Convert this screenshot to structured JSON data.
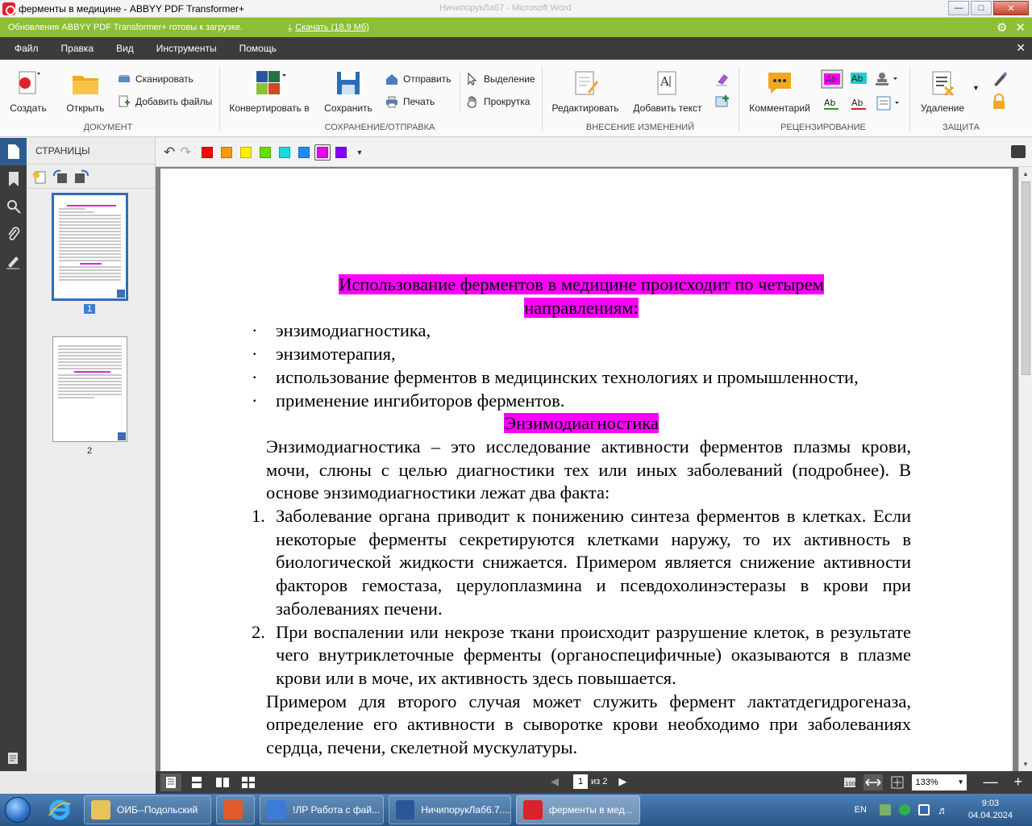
{
  "window": {
    "title": "ферменты в медицине - ABBYY PDF Transformer+",
    "ghost_title": "НичипорукЛаб7 - Microsoft Word"
  },
  "update_bar": {
    "message": "Обновления ABBYY PDF Transformer+ готовы к загрузке.",
    "download_link": "Скачать (18,9 Мб)"
  },
  "menu": [
    "Файл",
    "Правка",
    "Вид",
    "Инструменты",
    "Помощь"
  ],
  "ribbon": {
    "document": {
      "label": "ДОКУМЕНТ",
      "create": "Создать",
      "open": "Открыть",
      "scan": "Сканировать",
      "add_files": "Добавить файлы"
    },
    "save_send": {
      "label": "СОХРАНЕНИЕ/ОТПРАВКА",
      "convert": "Конвертировать в",
      "save": "Сохранить",
      "send": "Отправить",
      "print": "Печать",
      "select": "Выделение",
      "scroll": "Прокрутка"
    },
    "edit": {
      "label": "ВНЕСЕНИЕ ИЗМЕНЕНИЙ",
      "edit": "Редактировать",
      "add_text": "Добавить текст"
    },
    "review": {
      "label": "РЕЦЕНЗИРОВАНИЕ",
      "comment": "Комментарий"
    },
    "protect": {
      "label": "ЗАЩИТА",
      "delete": "Удаление"
    }
  },
  "pages_panel": {
    "header": "СТРАНИЦЫ",
    "pages": [
      "1",
      "2"
    ],
    "selected": "1"
  },
  "annot_colors": [
    "#ff0000",
    "#ff9900",
    "#ffee00",
    "#66dd00",
    "#11dddd",
    "#2288ff",
    "#ee00ee",
    "#8800ff"
  ],
  "selected_color": "#ee00ee",
  "document": {
    "heading1_a": "Использование ферментов в медицине происходит по четырем",
    "heading1_b": "направлениям",
    "heading1_colon": ":",
    "bullet_mark": "·",
    "bullets": [
      "энзимодиагностика,",
      "энзимотерапия,",
      "использование ферментов в медицинских технологиях и промышленности,",
      "применение ингибиторов ферментов."
    ],
    "heading2": "Энзимодиагностика",
    "para1": "Энзимодиагностика – это исследование активности ферментов плазмы крови, мочи, слюны с целью диагностики тех или иных заболеваний (подробнее). В основе энзимодиагностики лежат два факта:",
    "numbered": [
      {
        "n": "1.",
        "text": "Заболевание органа приводит к понижению синтеза ферментов в клетках. Если некоторые ферменты секретируются клетками наружу, то их активность в биологической жидкости снижается. Примером является снижение активности факторов гемостаза, церулоплазмина и псевдохолинэстеразы в крови при заболеваниях печени."
      },
      {
        "n": "2.",
        "text": "При воспалении или некрозе ткани происходит разрушение клеток, в результате чего внутриклеточные ферменты (органоспецифичные) оказываются в плазме крови или в моче, их активность здесь повышается."
      }
    ],
    "para2": "Примером для второго случая может служить фермент лактатдегидрогеназа, определение его активности в сыворотке крови необходимо при заболеваниях сердца, печени, скелетной мускулатуры."
  },
  "status": {
    "current_page": "1",
    "of_pages": "из 2",
    "zoom": "133%"
  },
  "taskbar": {
    "items": [
      {
        "label": "ОИБ--Подольский",
        "color": "#e8c25a"
      },
      {
        "label": "",
        "color": "#e05a2a"
      },
      {
        "label": "!ЛР Работа с фай...",
        "color": "#3d7bd8"
      },
      {
        "label": "НичипорукЛаб6.7....",
        "color": "#2b579a"
      },
      {
        "label": "ферменты в мед...",
        "color": "#d8232a"
      }
    ],
    "lang": "EN",
    "time": "9:03",
    "date": "04.04.2024"
  }
}
